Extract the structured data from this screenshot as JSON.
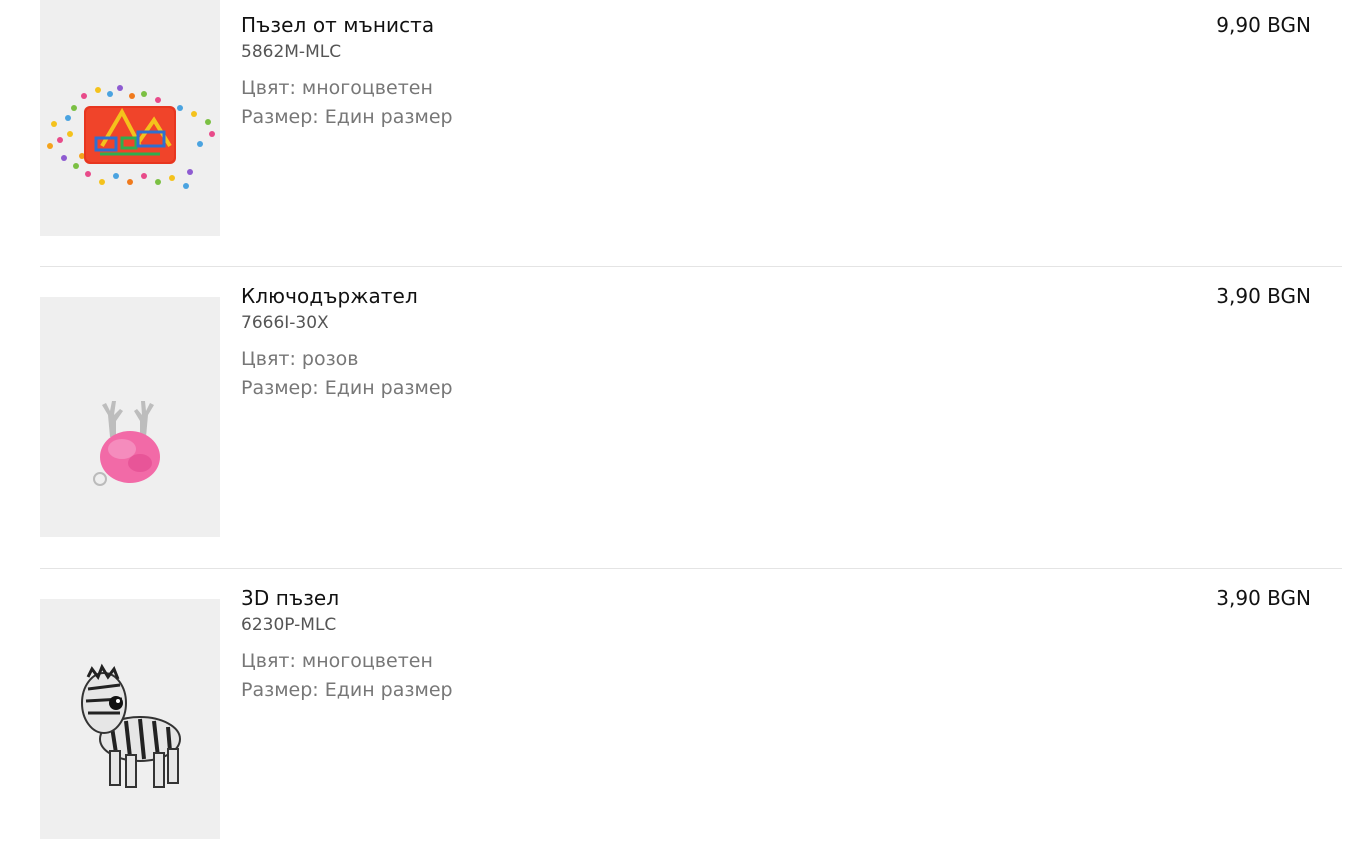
{
  "items": [
    {
      "title": "Пъзел от мъниста",
      "sku": "5862M-MLC",
      "color_label": "Цвят: многоцветен",
      "size_label": "Размер: Един размер",
      "price": "9,90 BGN",
      "image_icon": "bead-puzzle-image"
    },
    {
      "title": "Ключодържател",
      "sku": "7666I-30X",
      "color_label": "Цвят: розов",
      "size_label": "Размер: Един размер",
      "price": "3,90 BGN",
      "image_icon": "pink-pompom-keychain-image"
    },
    {
      "title": "3D пъзел",
      "sku": "6230P-MLC",
      "color_label": "Цвят: многоцветен",
      "size_label": "Размер: Един размер",
      "price": "3,90 BGN",
      "image_icon": "zebra-3d-puzzle-image"
    }
  ]
}
